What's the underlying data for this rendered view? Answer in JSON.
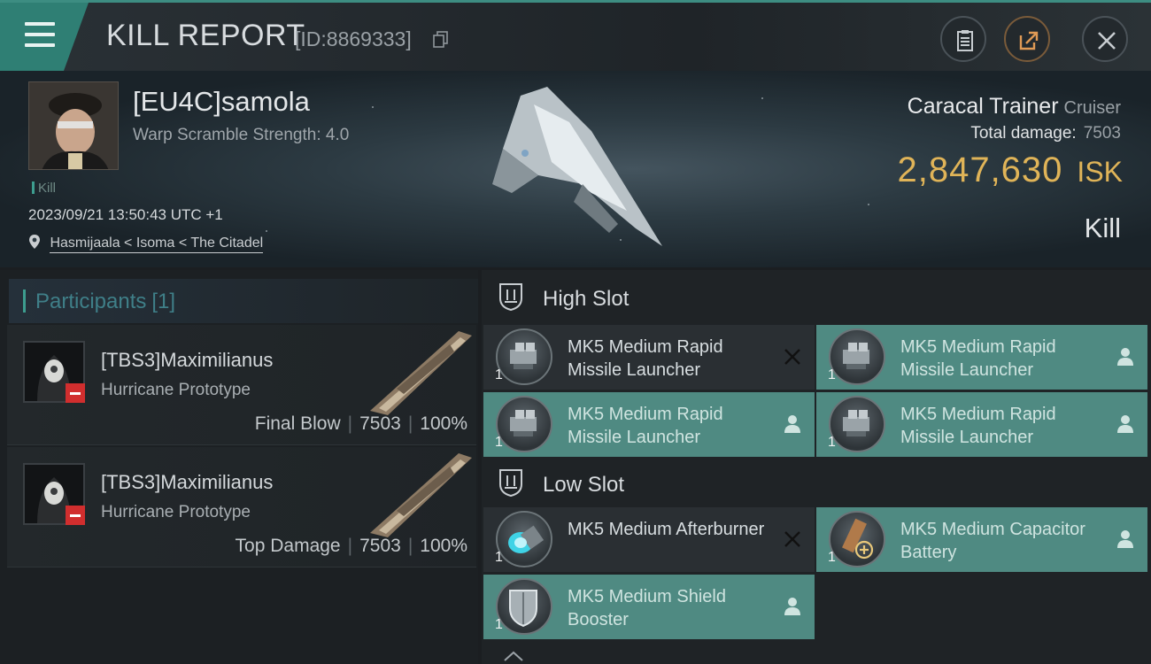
{
  "header": {
    "title": "KILL REPORT",
    "report_id": "[ID:8869333]"
  },
  "victim": {
    "name": "[EU4C]samola",
    "warp_scramble": "Warp Scramble Strength: 4.0",
    "kill_tag": "Kill",
    "datetime": "2023/09/21 13:50:43 UTC +1",
    "location": "Hasmijaala < Isoma < The Citadel",
    "ship_name": "Caracal Trainer",
    "ship_class": "Cruiser",
    "total_damage_label": "Total damage:",
    "total_damage": "7503",
    "isk_value": "2,847,630",
    "isk_unit": "ISK",
    "result": "Kill"
  },
  "participants": {
    "label": "Participants",
    "count": "[1]",
    "items": [
      {
        "name": "[TBS3]Maximilianus",
        "ship": "Hurricane Prototype",
        "role": "Final Blow",
        "damage": "7503",
        "percent": "100%"
      },
      {
        "name": "[TBS3]Maximilianus",
        "ship": "Hurricane Prototype",
        "role": "Top Damage",
        "damage": "7503",
        "percent": "100%"
      }
    ]
  },
  "slots": {
    "high": {
      "title": "High Slot",
      "modules": [
        {
          "qty": "1",
          "name": "MK5 Medium Rapid Missile Launcher",
          "status": "destroyed"
        },
        {
          "qty": "1",
          "name": "MK5 Medium Rapid Missile Launcher",
          "status": "dropped"
        },
        {
          "qty": "1",
          "name": "MK5 Medium Rapid Missile Launcher",
          "status": "dropped"
        },
        {
          "qty": "1",
          "name": "MK5 Medium Rapid Missile Launcher",
          "status": "dropped"
        }
      ]
    },
    "low": {
      "title": "Low Slot",
      "modules": [
        {
          "qty": "1",
          "name": "MK5 Medium Afterburner",
          "status": "destroyed"
        },
        {
          "qty": "1",
          "name": "MK5 Medium Capacitor Battery",
          "status": "dropped"
        },
        {
          "qty": "1",
          "name": "MK5 Medium Shield Booster",
          "status": "dropped"
        }
      ]
    }
  },
  "colors": {
    "accent_teal": "#4f8a82",
    "isk_gold": "#e0b458",
    "alert_red": "#d12e2e"
  }
}
